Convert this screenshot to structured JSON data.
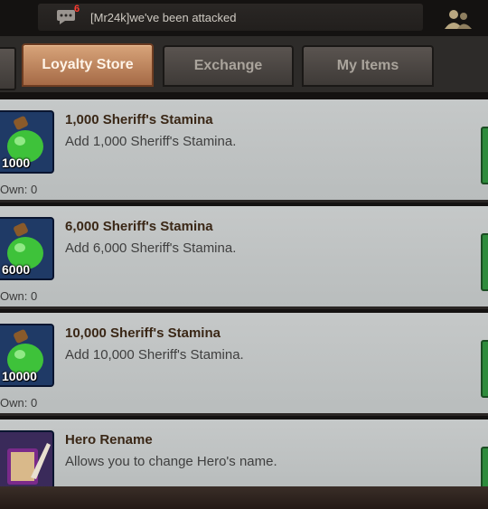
{
  "chat": {
    "badge": "6",
    "message": "[Mr24k]we've been attacked"
  },
  "tabs": [
    {
      "label": "Loyalty Store",
      "active": true
    },
    {
      "label": "Exchange",
      "active": false
    },
    {
      "label": "My Items",
      "active": false
    }
  ],
  "items": [
    {
      "name": "1,000 Sheriff's Stamina",
      "description": "Add 1,000 Sheriff's Stamina.",
      "quantity_label": "1000",
      "own": "Own: 0",
      "icon": "stamina-potion-icon"
    },
    {
      "name": "6,000 Sheriff's Stamina",
      "description": "Add 6,000 Sheriff's Stamina.",
      "quantity_label": "6000",
      "own": "Own: 0",
      "icon": "stamina-potion-icon"
    },
    {
      "name": "10,000 Sheriff's Stamina",
      "description": "Add 10,000 Sheriff's Stamina.",
      "quantity_label": "10000",
      "own": "Own: 0",
      "icon": "stamina-potion-icon"
    },
    {
      "name": "Hero Rename",
      "description": "Allows you to change Hero's name.",
      "quantity_label": "",
      "own": "",
      "icon": "rename-book-icon"
    }
  ],
  "colors": {
    "accent": "#b97a52",
    "buy_button": "#2e8b3c"
  }
}
